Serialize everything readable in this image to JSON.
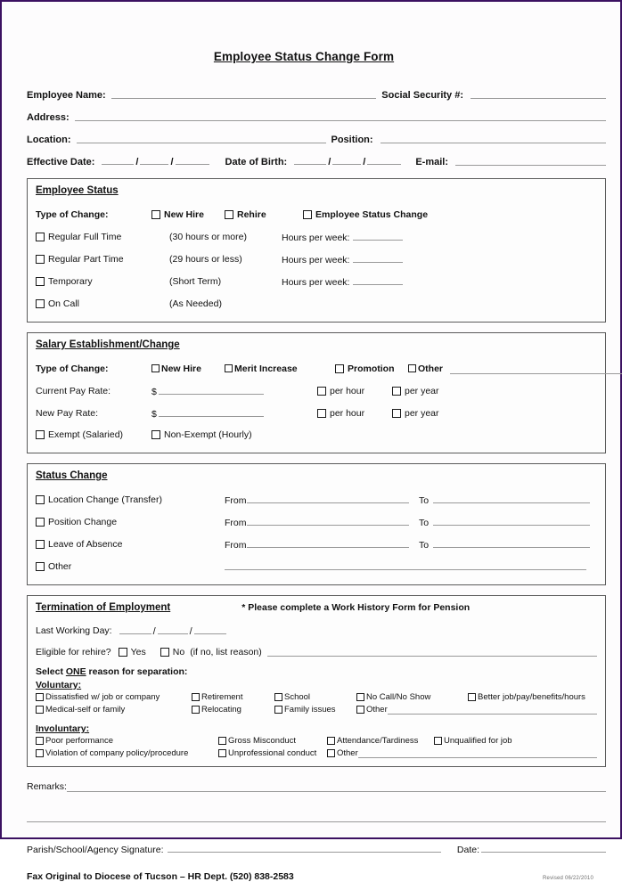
{
  "document": {
    "title": "Employee Status Change Form"
  },
  "identity": {
    "employee_name_label": "Employee Name:",
    "ssn_label": "Social Security #:",
    "address_label": "Address:",
    "location_label": "Location:",
    "position_label": "Position:",
    "effective_date_label": "Effective Date:",
    "date_of_birth_label": "Date of Birth:",
    "email_label": "E-mail:",
    "date_separator": "/"
  },
  "employee_status": {
    "section_title": "Employee Status",
    "type_of_change_label": "Type of Change:",
    "type_options": [
      "New Hire",
      "Rehire",
      "Employee Status Change"
    ],
    "hours_per_week_label": "Hours per week:",
    "rows": [
      {
        "name": "Regular Full Time",
        "detail": "(30 hours or more)",
        "has_hours": true
      },
      {
        "name": "Regular Part Time",
        "detail": "(29 hours or less)",
        "has_hours": true
      },
      {
        "name": "Temporary",
        "detail": "(Short Term)",
        "has_hours": true
      },
      {
        "name": "On Call",
        "detail": "(As Needed)",
        "has_hours": false
      }
    ]
  },
  "salary": {
    "section_title": "Salary Establishment/Change",
    "type_of_change_label": "Type of Change:",
    "type_options": [
      "New Hire",
      "Merit Increase",
      "Promotion",
      "Other"
    ],
    "current_pay_rate_label": "Current Pay Rate:",
    "new_pay_rate_label": "New Pay Rate:",
    "currency_symbol": "$",
    "per_hour_label": "per hour",
    "per_year_label": "per year",
    "exempt_label": "Exempt  (Salaried)",
    "non_exempt_label": "Non-Exempt   (Hourly)"
  },
  "status_change": {
    "section_title": "Status Change",
    "from_label": "From",
    "to_label": "To",
    "rows": [
      {
        "name": "Location Change (Transfer)",
        "has_from_to": true
      },
      {
        "name": "Position Change",
        "has_from_to": true
      },
      {
        "name": "Leave of Absence",
        "has_from_to": true
      },
      {
        "name": "Other",
        "has_from_to": false
      }
    ]
  },
  "termination": {
    "section_title": "Termination of Employment",
    "note": "* Please complete a Work History Form for Pension",
    "last_working_day_label": "Last Working Day:",
    "date_separator": "/",
    "eligible_label": "Eligible for rehire?",
    "yes_label": "Yes",
    "no_label": "No",
    "if_no_label": "(if no, list reason)",
    "select_one_prefix": "Select ",
    "select_one_emphasis": "ONE",
    "select_one_suffix": " reason for separation:",
    "voluntary_title": "Voluntary:",
    "voluntary_row1": [
      "Dissatisfied w/ job or company",
      "Retirement",
      "School",
      "No Call/No Show",
      "Better job/pay/benefits/hours"
    ],
    "voluntary_row2": [
      "Medical-self or family",
      "Relocating",
      "Family issues",
      "Other"
    ],
    "involuntary_title": "Involuntary:",
    "involuntary_row1": [
      "Poor performance",
      "Gross Misconduct",
      "Attendance/Tardiness",
      "Unqualified for job"
    ],
    "involuntary_row2": [
      "Violation of company policy/procedure",
      "Unprofessional conduct",
      "Other"
    ]
  },
  "footer": {
    "remarks_label": "Remarks:",
    "signature_label": "Parish/School/Agency Signature:",
    "date_label": "Date:",
    "fax_line": "Fax Original to Diocese of Tucson – HR Dept. (520) 838-2583",
    "revised": "Revised 06/22/2010"
  }
}
